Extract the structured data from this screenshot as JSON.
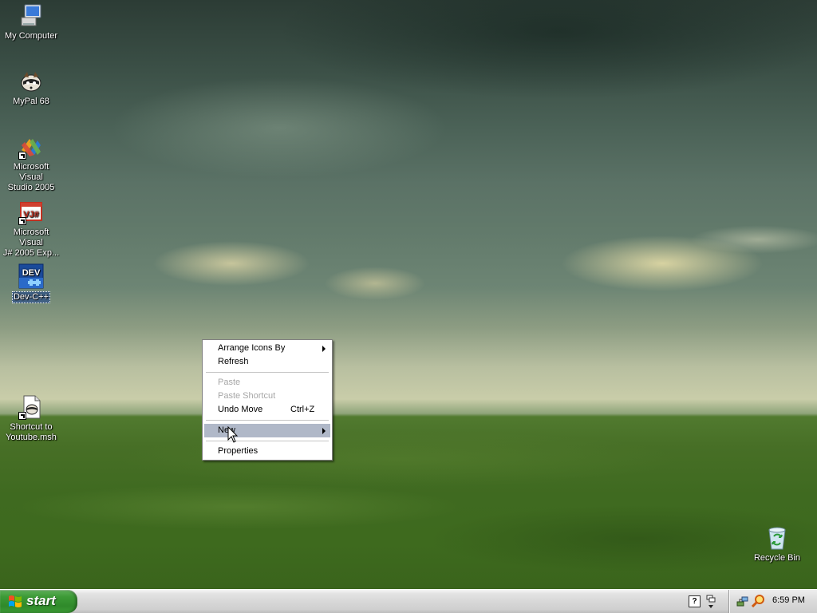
{
  "desktop_icons": [
    {
      "label": "My Computer",
      "icon": "computer-icon"
    },
    {
      "label": "MyPal 68",
      "icon": "raccoon-icon"
    },
    {
      "label_line1": "Microsoft Visual",
      "label_line2": "Studio 2005",
      "icon": "visual-studio-icon"
    },
    {
      "label_line1": "Microsoft Visual",
      "label_line2": "J# 2005 Exp...",
      "icon": "vj-sharp-icon",
      "badge": "VJ#"
    },
    {
      "label": "Dev-C++",
      "icon": "dev-cpp-icon",
      "badge": "DEV",
      "selected": true
    },
    {
      "label_line1": "Shortcut to",
      "label_line2": "Youtube.msh",
      "icon": "script-file-icon"
    },
    {
      "label": "Recycle Bin",
      "icon": "recycle-bin-icon"
    }
  ],
  "context_menu": {
    "items": [
      {
        "label": "Arrange Icons By",
        "submenu": true
      },
      {
        "label": "Refresh"
      },
      {
        "label": "Paste",
        "disabled": true
      },
      {
        "label": "Paste Shortcut",
        "disabled": true
      },
      {
        "label": "Undo Move",
        "accelerator": "Ctrl+Z"
      },
      {
        "label": "New",
        "submenu": true,
        "highlighted": true
      },
      {
        "label": "Properties"
      }
    ]
  },
  "taskbar": {
    "start_label": "start",
    "clock": "6:59 PM",
    "tray_icons": [
      "help-icon",
      "double-arrow-icon",
      "network-icon",
      "search-magnifier-icon"
    ]
  },
  "colors": {
    "start_green": "#3c9a36",
    "menu_highlight": "#b0b8c8",
    "taskbar_silver": "#d8d8d8"
  }
}
